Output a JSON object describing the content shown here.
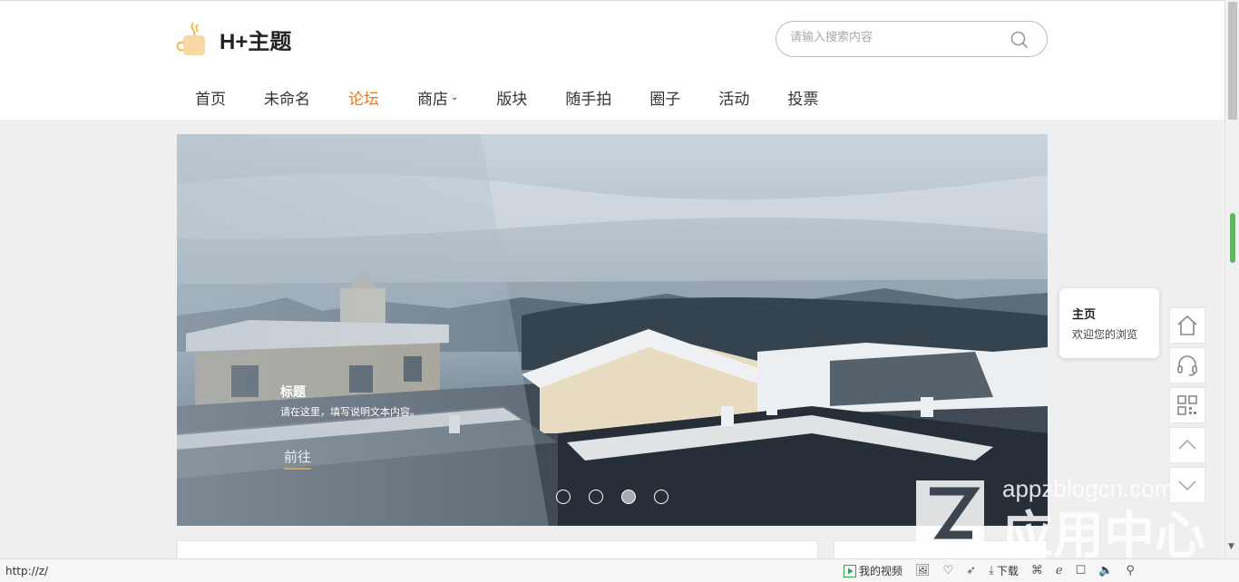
{
  "header": {
    "logo_text": "H+主题",
    "search_placeholder": "请输入搜索内容"
  },
  "nav": [
    {
      "label": "首页"
    },
    {
      "label": "未命名"
    },
    {
      "label": "论坛",
      "active": true
    },
    {
      "label": "商店",
      "has_dropdown": true
    },
    {
      "label": "版块"
    },
    {
      "label": "随手拍"
    },
    {
      "label": "圈子"
    },
    {
      "label": "活动"
    },
    {
      "label": "投票"
    }
  ],
  "banner": {
    "caption_title": "标题",
    "caption_desc": "请在这里，填写说明文本内容。",
    "cta_label": "前往",
    "slide_count": 4,
    "active_slide": 3
  },
  "side_tooltip": {
    "title": "主页",
    "subtitle": "欢迎您的浏览"
  },
  "side_buttons": [
    "home-icon",
    "headset-icon",
    "qrcode-icon",
    "arrow-up-icon",
    "arrow-down-icon"
  ],
  "statusbar": {
    "url": "http://z/",
    "video_label": "我的视频",
    "download_label": "下载"
  },
  "watermark": {
    "domain": "appzblogcn.com",
    "brand": "应用中心"
  },
  "colors": {
    "accent": "#e87722",
    "cta_underline": "#c8a36a",
    "scroll_indicator": "#5cb85c"
  }
}
